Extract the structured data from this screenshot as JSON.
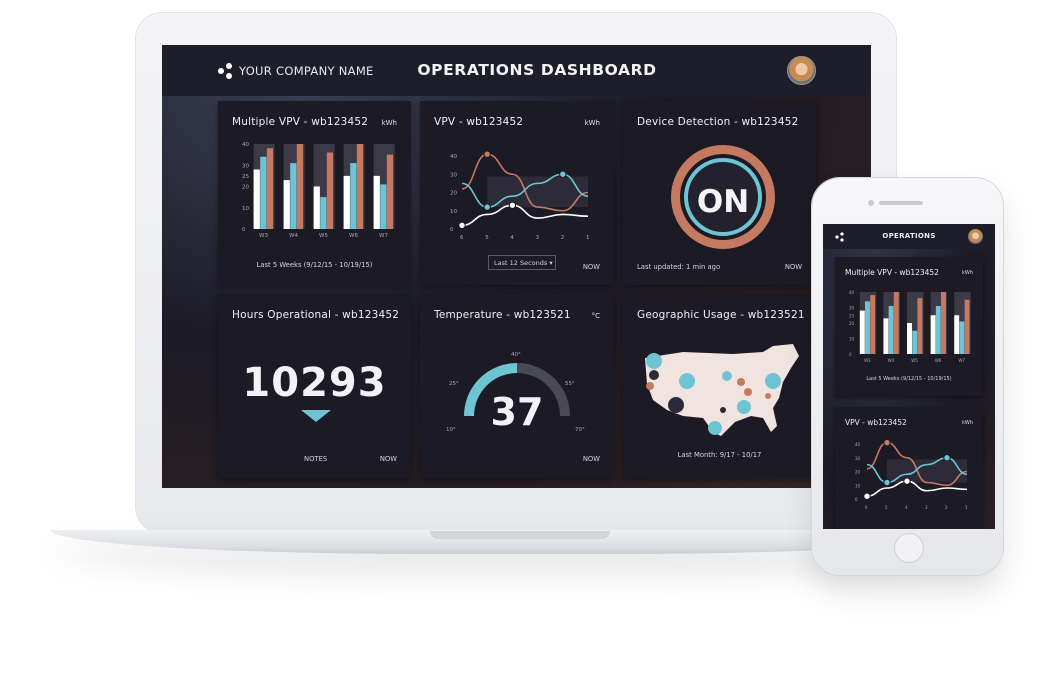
{
  "header": {
    "company": "YOUR COMPANY NAME",
    "title": "OPERATIONS DASHBOARD"
  },
  "colors": {
    "teal": "#6fc4d3",
    "coral": "#c47a60",
    "white": "#ffffff",
    "bg": "#1b1a25"
  },
  "cards": {
    "multi_vpv": {
      "title": "Multiple VPV - wb123452",
      "unit": "kWh",
      "footer": "Last 5 Weeks (9/12/15 - 10/19/15)"
    },
    "vpv": {
      "title": "VPV - wb123452",
      "unit": "kWh",
      "dropdown": "Last 12 Seconds",
      "dropdown_icon": "caret-down-icon",
      "now": "NOW"
    },
    "device": {
      "title": "Device Detection - wb123452",
      "status": "ON",
      "updated": "Last updated: 1 min ago",
      "now": "NOW"
    },
    "hours": {
      "title": "Hours Operational - wb123452",
      "value": "10293",
      "notes": "NOTES",
      "now": "NOW"
    },
    "temperature": {
      "title": "Temperature - wb123521",
      "unit": "°C",
      "value": "37",
      "labels": [
        "10°",
        "25°",
        "40°",
        "55°",
        "70°"
      ],
      "now": "NOW"
    },
    "geo": {
      "title": "Geographic Usage - wb123521",
      "footer": "Last Month: 9/17 - 10/17"
    }
  },
  "phone": {
    "title": "OPERATIONS",
    "card1_title": "Multiple VPV - wb123452",
    "card1_unit": "kWh",
    "card1_footer": "Last 5 Weeks (9/12/15 - 10/19/15)",
    "card2_title": "VPV - wb123452",
    "card2_unit": "kWh"
  },
  "chart_data": [
    {
      "type": "bar",
      "title": "Multiple VPV - wb123452",
      "categories": [
        "W3",
        "W4",
        "W5",
        "W6",
        "W7"
      ],
      "ylim": [
        0,
        40
      ],
      "yticks": [
        0,
        10,
        20,
        25,
        30,
        40
      ],
      "series": [
        {
          "values": [
            28,
            23,
            20,
            25,
            25
          ],
          "color": "#ffffff"
        },
        {
          "values": [
            34,
            31,
            15,
            31,
            21
          ],
          "color": "#6fc4d3"
        },
        {
          "values": [
            38,
            45,
            36,
            40,
            35
          ],
          "color": "#c47a60"
        }
      ]
    },
    {
      "type": "line",
      "title": "VPV - wb123452",
      "x": [
        6,
        5,
        4,
        3,
        2,
        1
      ],
      "ylim": [
        0,
        40
      ],
      "yticks": [
        0,
        10,
        20,
        30,
        40
      ],
      "series": [
        {
          "values": [
            22,
            41,
            30,
            12,
            10,
            20
          ],
          "color": "#c47a60",
          "marker_index": 1
        },
        {
          "values": [
            25,
            12,
            18,
            25,
            30,
            18
          ],
          "color": "#6fc4d3",
          "marker_index": 1,
          "marker_index2": 4
        },
        {
          "values": [
            2,
            8,
            13,
            6,
            8,
            7
          ],
          "color": "#ffffff",
          "marker_index": 0,
          "marker_index2": 2
        }
      ]
    }
  ]
}
